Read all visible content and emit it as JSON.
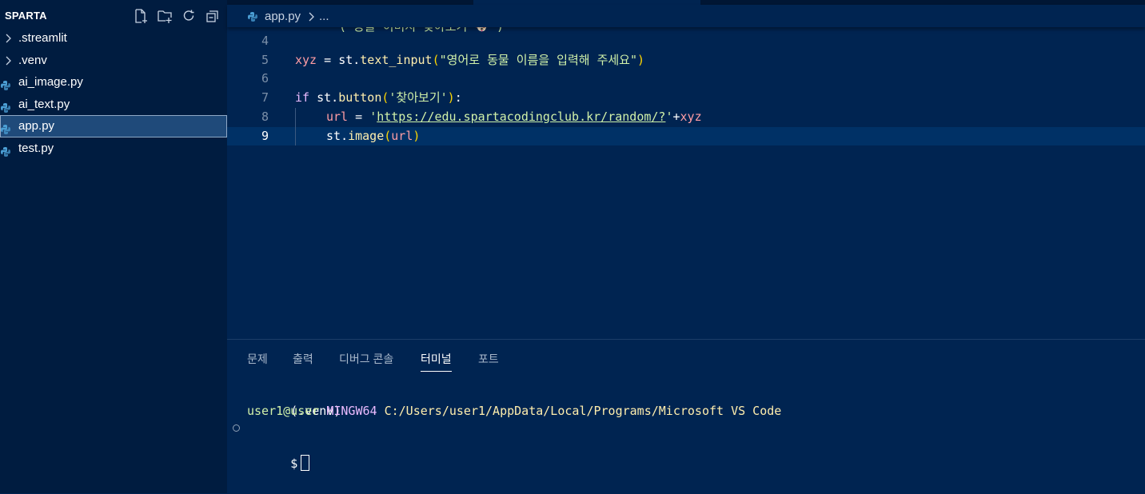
{
  "explorer": {
    "title": "SPARTA",
    "actions": [
      "new-file-icon",
      "new-folder-icon",
      "refresh-icon",
      "collapse-all-icon"
    ],
    "items": [
      {
        "label": ".streamlit",
        "type": "folder"
      },
      {
        "label": ".venv",
        "type": "folder"
      },
      {
        "label": "ai_image.py",
        "type": "python"
      },
      {
        "label": "ai_text.py",
        "type": "python"
      },
      {
        "label": "app.py",
        "type": "python",
        "selected": true
      },
      {
        "label": "test.py",
        "type": "python"
      }
    ]
  },
  "breadcrumb": {
    "file": "app.py",
    "more": "..."
  },
  "editor": {
    "line_numbers": [
      "4",
      "5",
      "6",
      "7",
      "8",
      "9"
    ],
    "current_line": "9",
    "partial_top": "( 동물 이미지 찾아보기 🐶 )",
    "line5": {
      "var": "xyz",
      "op": " = ",
      "obj": "st",
      "dot": ".",
      "fn": "text_input",
      "open": "(",
      "str": "\"영어로 동물 이름을 입력해 주세요\"",
      "close": ")"
    },
    "line7": {
      "kw": "if",
      "sp": " ",
      "obj": "st",
      "dot": ".",
      "fn": "button",
      "open": "(",
      "str": "'찾아보기'",
      "close": ")",
      "colon": ":"
    },
    "line8": {
      "var": "url",
      "op": " = ",
      "q1": "'",
      "url": "https://edu.spartacodingclub.kr/random/?",
      "q2": "'",
      "plus": "+",
      "var2": "xyz"
    },
    "line9": {
      "obj": "st",
      "dot": ".",
      "fn": "image",
      "open": "(",
      "arg": "url",
      "close": ")"
    }
  },
  "panel": {
    "tabs": [
      {
        "label": "문제",
        "active": false
      },
      {
        "label": "출력",
        "active": false
      },
      {
        "label": "디버그 콘솔",
        "active": false
      },
      {
        "label": "터미널",
        "active": true
      },
      {
        "label": "포트",
        "active": false
      }
    ],
    "terminal": {
      "env": "(.venv)",
      "user": "user1@user",
      "system": "MINGW64",
      "path": "C:/Users/user1/AppData/Local/Programs/Microsoft VS Code",
      "prompt": "$"
    }
  },
  "colors": {
    "background": "#002451",
    "sidebar": "#001c40",
    "string": "#d1f1a9",
    "keyword": "#ebbbff",
    "function": "#ffeead",
    "variable": "#ff9da4"
  }
}
